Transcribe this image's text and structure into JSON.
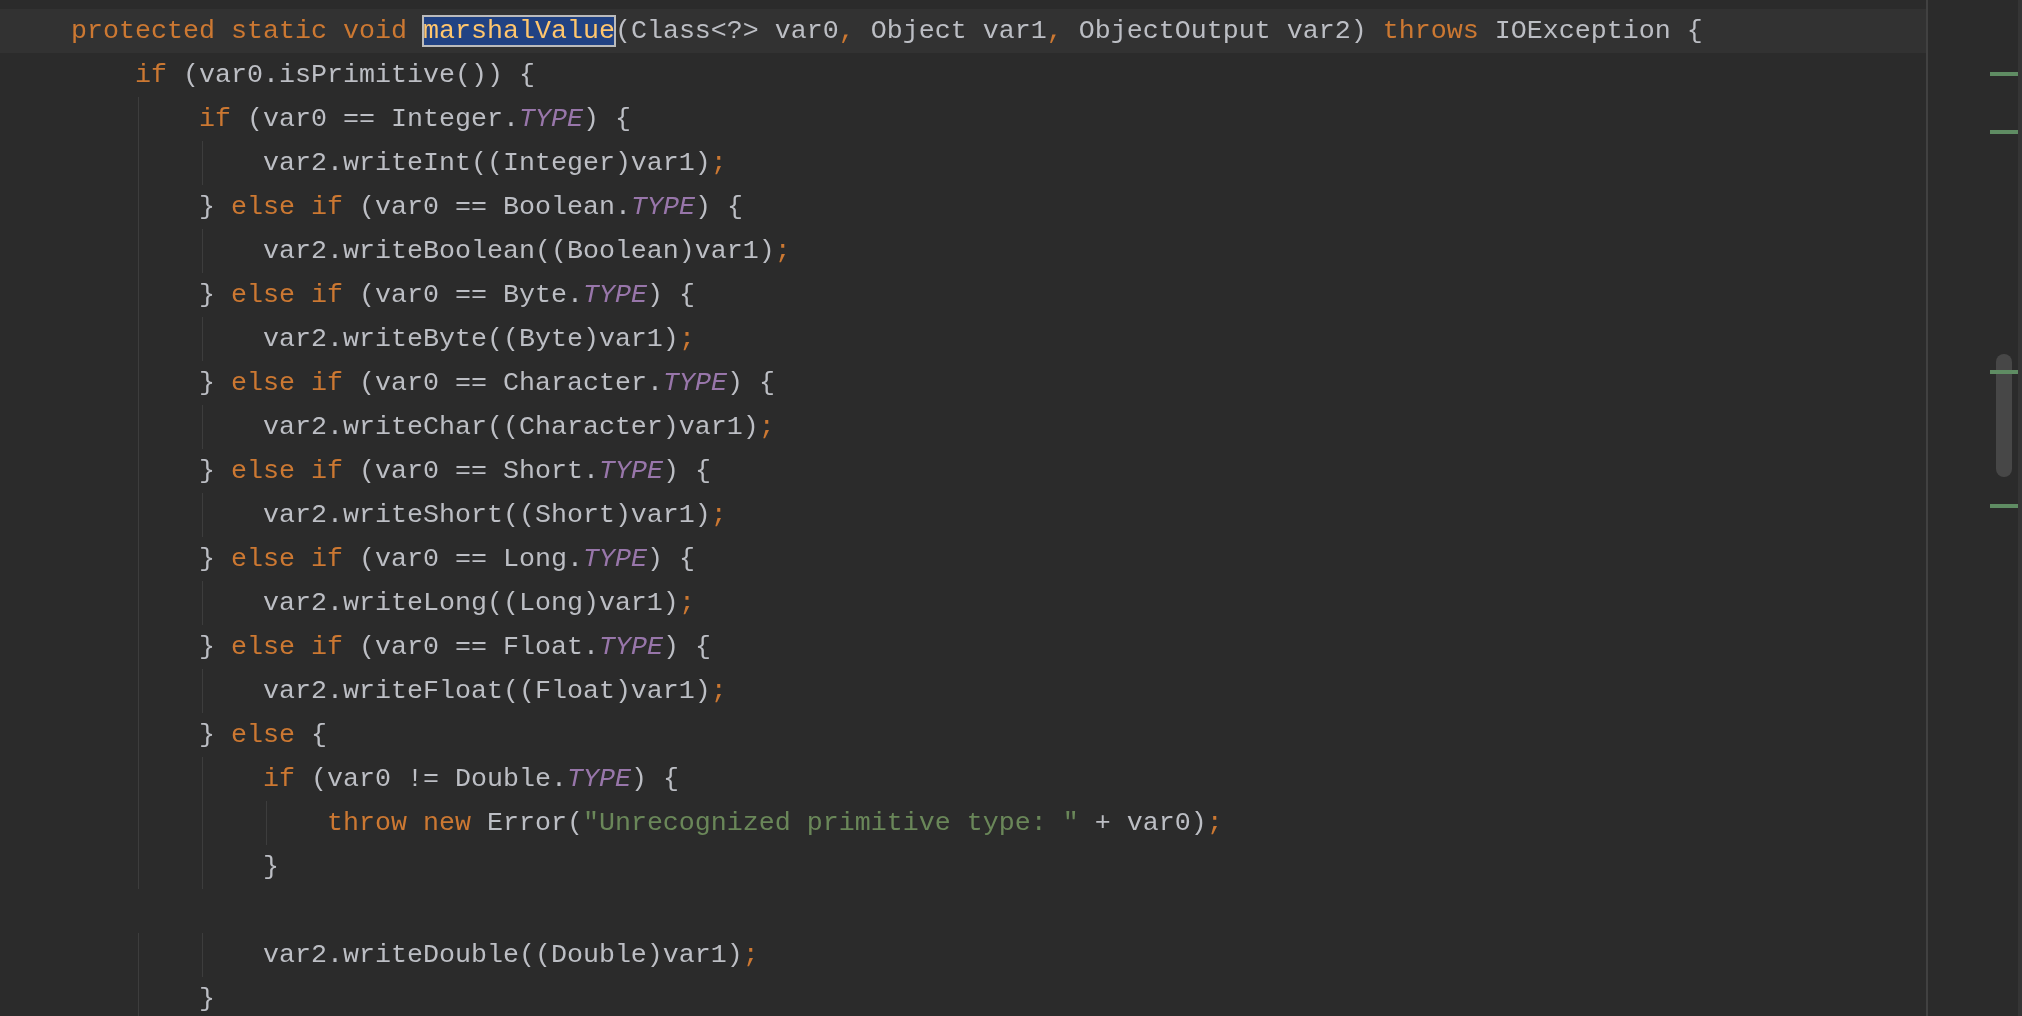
{
  "editor": {
    "lines": [
      {
        "current": true,
        "tokens": [
          {
            "text": "protected static void ",
            "kind": "keyword"
          },
          {
            "text": "marshalValue",
            "kind": "selected-name"
          },
          {
            "text": "(Class<?> var0",
            "kind": "plain"
          },
          {
            "text": ",",
            "kind": "punct"
          },
          {
            "text": " Object var1",
            "kind": "plain"
          },
          {
            "text": ",",
            "kind": "punct"
          },
          {
            "text": " ObjectOutput var2) ",
            "kind": "plain"
          },
          {
            "text": "throws ",
            "kind": "keyword"
          },
          {
            "text": "IOException {",
            "kind": "plain"
          }
        ]
      },
      {
        "current": false,
        "tokens": [
          {
            "text": "    if ",
            "kind": "keyword"
          },
          {
            "text": "(var0.isPrimitive()) {",
            "kind": "plain"
          }
        ]
      },
      {
        "current": false,
        "tokens": [
          {
            "text": "        if ",
            "kind": "keyword"
          },
          {
            "text": "(var0 == Integer.",
            "kind": "plain"
          },
          {
            "text": "TYPE",
            "kind": "constant"
          },
          {
            "text": ") {",
            "kind": "plain"
          }
        ]
      },
      {
        "current": false,
        "tokens": [
          {
            "text": "            var2.writeInt((Integer)var1)",
            "kind": "plain"
          },
          {
            "text": ";",
            "kind": "punct"
          }
        ]
      },
      {
        "current": false,
        "tokens": [
          {
            "text": "        } ",
            "kind": "plain"
          },
          {
            "text": "else if ",
            "kind": "keyword"
          },
          {
            "text": "(var0 == Boolean.",
            "kind": "plain"
          },
          {
            "text": "TYPE",
            "kind": "constant"
          },
          {
            "text": ") {",
            "kind": "plain"
          }
        ]
      },
      {
        "current": false,
        "tokens": [
          {
            "text": "            var2.writeBoolean((Boolean)var1)",
            "kind": "plain"
          },
          {
            "text": ";",
            "kind": "punct"
          }
        ]
      },
      {
        "current": false,
        "tokens": [
          {
            "text": "        } ",
            "kind": "plain"
          },
          {
            "text": "else if ",
            "kind": "keyword"
          },
          {
            "text": "(var0 == Byte.",
            "kind": "plain"
          },
          {
            "text": "TYPE",
            "kind": "constant"
          },
          {
            "text": ") {",
            "kind": "plain"
          }
        ]
      },
      {
        "current": false,
        "tokens": [
          {
            "text": "            var2.writeByte((Byte)var1)",
            "kind": "plain"
          },
          {
            "text": ";",
            "kind": "punct"
          }
        ]
      },
      {
        "current": false,
        "tokens": [
          {
            "text": "        } ",
            "kind": "plain"
          },
          {
            "text": "else if ",
            "kind": "keyword"
          },
          {
            "text": "(var0 == Character.",
            "kind": "plain"
          },
          {
            "text": "TYPE",
            "kind": "constant"
          },
          {
            "text": ") {",
            "kind": "plain"
          }
        ]
      },
      {
        "current": false,
        "tokens": [
          {
            "text": "            var2.writeChar((Character)var1)",
            "kind": "plain"
          },
          {
            "text": ";",
            "kind": "punct"
          }
        ]
      },
      {
        "current": false,
        "tokens": [
          {
            "text": "        } ",
            "kind": "plain"
          },
          {
            "text": "else if ",
            "kind": "keyword"
          },
          {
            "text": "(var0 == Short.",
            "kind": "plain"
          },
          {
            "text": "TYPE",
            "kind": "constant"
          },
          {
            "text": ") {",
            "kind": "plain"
          }
        ]
      },
      {
        "current": false,
        "tokens": [
          {
            "text": "            var2.writeShort((Short)var1)",
            "kind": "plain"
          },
          {
            "text": ";",
            "kind": "punct"
          }
        ]
      },
      {
        "current": false,
        "tokens": [
          {
            "text": "        } ",
            "kind": "plain"
          },
          {
            "text": "else if ",
            "kind": "keyword"
          },
          {
            "text": "(var0 == Long.",
            "kind": "plain"
          },
          {
            "text": "TYPE",
            "kind": "constant"
          },
          {
            "text": ") {",
            "kind": "plain"
          }
        ]
      },
      {
        "current": false,
        "tokens": [
          {
            "text": "            var2.writeLong((Long)var1)",
            "kind": "plain"
          },
          {
            "text": ";",
            "kind": "punct"
          }
        ]
      },
      {
        "current": false,
        "tokens": [
          {
            "text": "        } ",
            "kind": "plain"
          },
          {
            "text": "else if ",
            "kind": "keyword"
          },
          {
            "text": "(var0 == Float.",
            "kind": "plain"
          },
          {
            "text": "TYPE",
            "kind": "constant"
          },
          {
            "text": ") {",
            "kind": "plain"
          }
        ]
      },
      {
        "current": false,
        "tokens": [
          {
            "text": "            var2.writeFloat((Float)var1)",
            "kind": "plain"
          },
          {
            "text": ";",
            "kind": "punct"
          }
        ]
      },
      {
        "current": false,
        "tokens": [
          {
            "text": "        } ",
            "kind": "plain"
          },
          {
            "text": "else ",
            "kind": "keyword"
          },
          {
            "text": "{",
            "kind": "plain"
          }
        ]
      },
      {
        "current": false,
        "tokens": [
          {
            "text": "            if ",
            "kind": "keyword"
          },
          {
            "text": "(var0 != Double.",
            "kind": "plain"
          },
          {
            "text": "TYPE",
            "kind": "constant"
          },
          {
            "text": ") {",
            "kind": "plain"
          }
        ]
      },
      {
        "current": false,
        "tokens": [
          {
            "text": "                throw new ",
            "kind": "keyword"
          },
          {
            "text": "Error(",
            "kind": "plain"
          },
          {
            "text": "\"Unrecognized primitive type: \"",
            "kind": "string"
          },
          {
            "text": " + var0)",
            "kind": "plain"
          },
          {
            "text": ";",
            "kind": "punct"
          }
        ]
      },
      {
        "current": false,
        "tokens": [
          {
            "text": "            }",
            "kind": "plain"
          }
        ]
      },
      {
        "kind": "blank"
      },
      {
        "current": false,
        "tokens": [
          {
            "text": "            var2.writeDouble((Double)var1)",
            "kind": "plain"
          },
          {
            "text": ";",
            "kind": "punct"
          }
        ]
      },
      {
        "current": false,
        "tokens": [
          {
            "text": "        }",
            "kind": "plain"
          }
        ]
      }
    ]
  }
}
